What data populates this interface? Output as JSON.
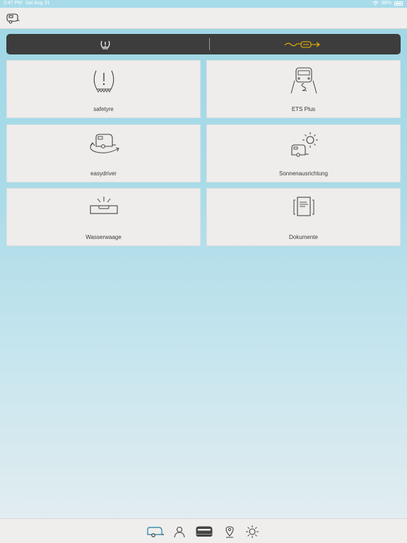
{
  "status_bar": {
    "time": "2:47 PM",
    "date": "Sat Aug 31",
    "battery": "88%",
    "icons": [
      "wifi-icon",
      "battery-icon"
    ]
  },
  "topbar": {
    "back_icon": "caravan-icon"
  },
  "segment": {
    "left_icon": "tyre-warning-icon",
    "right_icon": "connection-cable-icon",
    "accent_color": "#f2b705",
    "background": "#3d3d3d"
  },
  "tiles": [
    {
      "label": "safetyre",
      "icon": "tyre-warning-icon"
    },
    {
      "label": "ETS Plus",
      "icon": "vehicle-stabilization-icon"
    },
    {
      "label": "easydriver",
      "icon": "caravan-maneuver-icon"
    },
    {
      "label": "Sonnenausrichtung",
      "icon": "caravan-sun-icon"
    },
    {
      "label": "Wasserwaage",
      "icon": "level-icon"
    },
    {
      "label": "Dokumente",
      "icon": "documents-icon"
    }
  ],
  "tabbar": {
    "items": [
      {
        "icon": "caravan-icon",
        "active": true
      },
      {
        "icon": "person-icon",
        "active": false
      },
      {
        "icon": "van-icon",
        "active": false
      },
      {
        "icon": "location-pin-icon",
        "active": false
      },
      {
        "icon": "sun-icon",
        "active": false
      }
    ]
  }
}
